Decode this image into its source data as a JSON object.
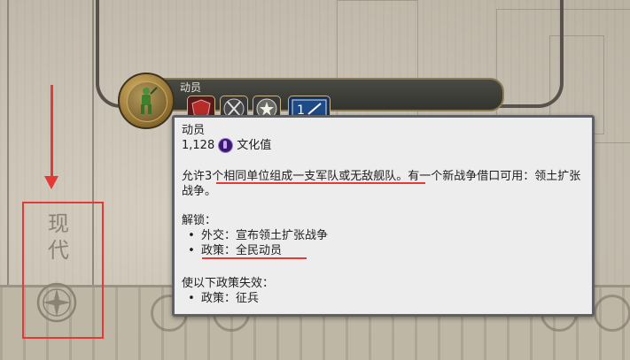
{
  "era": {
    "label": "现代"
  },
  "civic": {
    "name": "动员"
  },
  "tooltip": {
    "title": "动员",
    "cost_value": "1,128",
    "cost_unit": "文化值",
    "description": "允许3个相同单位组成一支军队或无敌舰队。有一个新战争借口可用：领土扩张战争。",
    "unlocks_heading": "解锁：",
    "unlocks": [
      {
        "bullet": "•",
        "text": "外交：宣布领土扩张战争"
      },
      {
        "bullet": "•",
        "text": "政策：全民动员"
      }
    ],
    "obsolete_heading": "使以下政策失效：",
    "obsolete": [
      {
        "bullet": "•",
        "text": "政策：征兵"
      }
    ]
  },
  "icons": {
    "unit": "soldier-icon",
    "unlock_1": "shield-icon",
    "unlock_2": "crossed-swords-icon",
    "unlock_3": "star-icon",
    "unlock_4": "policy-card-icon",
    "culture": "culture-icon",
    "era": "compass-icon"
  },
  "colors": {
    "annotation": "#e53935",
    "tooltip_bg": "#ecedec",
    "civic_bar": "#3f3f3a",
    "culture": "#3a1b6a"
  }
}
